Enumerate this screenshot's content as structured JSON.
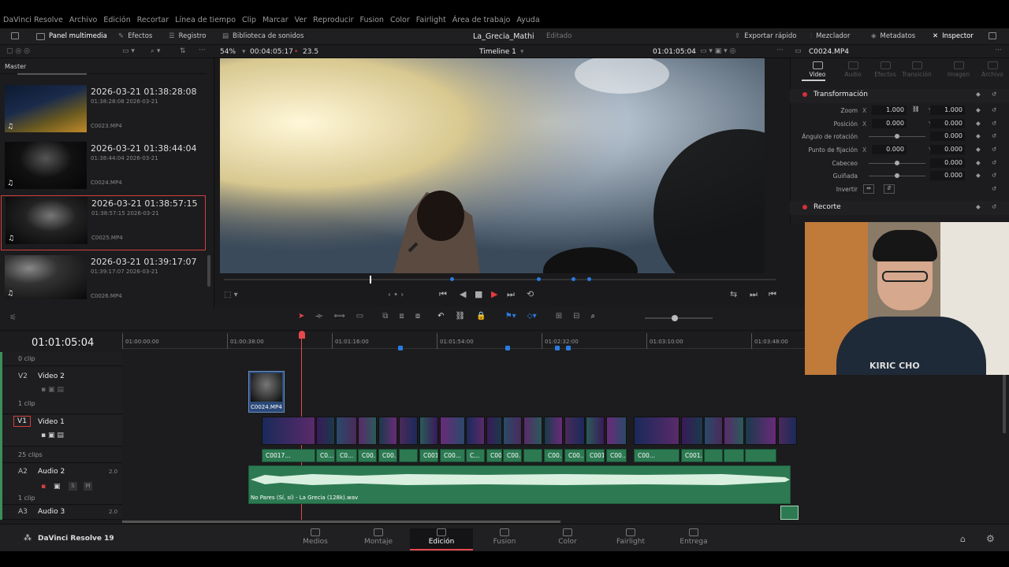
{
  "menu": {
    "items": [
      "DaVinci Resolve",
      "Archivo",
      "Edición",
      "Recortar",
      "Línea de tiempo",
      "Clip",
      "Marcar",
      "Ver",
      "Reproducir",
      "Fusion",
      "Color",
      "Fairlight",
      "Área de trabajo",
      "Ayuda"
    ]
  },
  "toolbar": {
    "panel_multimedia": "Panel multimedia",
    "efectos": "Efectos",
    "registro": "Registro",
    "biblioteca": "Biblioteca de sonidos",
    "project_title": "La_Grecia_Mathi",
    "project_status": "Editado",
    "exportar": "Exportar rápido",
    "mezclador": "Mezclador",
    "metadatos": "Metadatos",
    "inspector": "Inspector"
  },
  "viewer_bar": {
    "zoom": "54%",
    "duration": "00:04:05:17",
    "fps": "23.5",
    "timeline_name": "Timeline 1",
    "timecode": "01:01:05:04",
    "clip_name": "C0024.MP4"
  },
  "media_pool": {
    "bin": "Master",
    "clips": [
      {
        "title": "2026-03-21  01:38:28:08",
        "tc": "01:38:28:08",
        "date": "2026-03-21",
        "file": "C0023.MP4"
      },
      {
        "title": "2026-03-21  01:38:44:04",
        "tc": "01:38:44:04",
        "date": "2026-03-21",
        "file": "C0024.MP4"
      },
      {
        "title": "2026-03-21  01:38:57:15",
        "tc": "01:38:57:15",
        "date": "2026-03-21",
        "file": "C0025.MP4"
      },
      {
        "title": "2026-03-21  01:39:17:07",
        "tc": "01:39:17:07",
        "date": "2026-03-21",
        "file": "C0026.MP4"
      }
    ]
  },
  "inspector": {
    "tabs": [
      "Video",
      "Audio",
      "Efectos",
      "Transición",
      "Imagen",
      "Archivo"
    ],
    "section_transform": "Transformación",
    "zoom_label": "Zoom",
    "zoom_x": "1.000",
    "zoom_y": "1.000",
    "pos_label": "Posición",
    "pos_x": "0.000",
    "pos_y": "0.000",
    "rot_label": "Ángulo de rotación",
    "rot": "0.000",
    "anchor_label": "Punto de fijación",
    "anchor_x": "0.000",
    "anchor_y": "0.000",
    "pitch_label": "Cabeceo",
    "pitch": "0.000",
    "yaw_label": "Guiñada",
    "yaw": "0.000",
    "flip_label": "Invertir",
    "section_crop": "Recorte",
    "x": "X",
    "y": "Y"
  },
  "timeline": {
    "timecode": "01:01:05:04",
    "ruler": [
      "01:00:00:00",
      "01:00:38:00",
      "01:01:16:00",
      "01:01:54:00",
      "01:02:32:00",
      "01:03:10:00",
      "01:03:48:00"
    ],
    "tracks": {
      "v3_count": "0 clip",
      "v2_id": "V2",
      "v2_name": "Video 2",
      "v2_count": "1 clip",
      "v1_id": "V1",
      "v1_name": "Video 1",
      "a1_count": "25 clips",
      "a2_id": "A2",
      "a2_name": "Audio 2",
      "a2_level": "2.0",
      "a2_count": "1 clip",
      "a3_id": "A3",
      "a3_name": "Audio 3",
      "a3_level": "2.0",
      "s": "S",
      "m": "M"
    },
    "v2_clip": "C0024.MP4",
    "audio_file": "No Pares (Sí, sí) - La Grecia (128k).wav",
    "a1_clips": [
      "C0017...",
      "C0...",
      "C0...",
      "C00...",
      "C00...",
      "",
      "C0017...",
      "C00...",
      "C...",
      "C00...",
      "C00...",
      "",
      "C00...",
      "C00...",
      "C0017...",
      "C00...",
      "C00...",
      "C001..."
    ]
  },
  "pages": [
    "Medios",
    "Montaje",
    "Edición",
    "Fusion",
    "Color",
    "Fairlight",
    "Entrega"
  ],
  "app_name": "DaVinci Resolve 19",
  "webcam_text": "KIRIC CHO"
}
